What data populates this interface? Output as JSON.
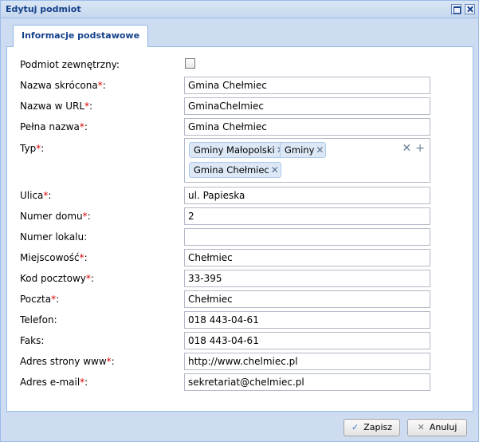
{
  "window": {
    "title": "Edytuj podmiot"
  },
  "tabs": [
    {
      "label": "Informacje podstawowe"
    }
  ],
  "form": {
    "external": {
      "label": "Podmiot zewnętrzny:",
      "checked": false
    },
    "short_name": {
      "label": "Nazwa skrócona",
      "value": "Gmina Chełmiec"
    },
    "url_name": {
      "label": "Nazwa w URL",
      "value": "GminaChelmiec"
    },
    "full_name": {
      "label": "Pełna nazwa",
      "value": "Gmina Chełmiec"
    },
    "type": {
      "label": "Typ",
      "tags": [
        "Gminy Małopolski",
        "Gminy",
        "Gmina Chełmiec"
      ]
    },
    "street": {
      "label": "Ulica",
      "value": "ul. Papieska"
    },
    "house_no": {
      "label": "Numer domu",
      "value": "2"
    },
    "flat_no": {
      "label": "Numer lokalu:",
      "value": ""
    },
    "city": {
      "label": "Miejscowość",
      "value": "Chełmiec"
    },
    "postal_code": {
      "label": "Kod pocztowy",
      "value": "33-395"
    },
    "post_office": {
      "label": "Poczta",
      "value": "Chełmiec"
    },
    "phone": {
      "label": "Telefon:",
      "value": "018 443-04-61"
    },
    "fax": {
      "label": "Faks:",
      "value": "018 443-04-61"
    },
    "website": {
      "label": "Adres strony www",
      "value": "http://www.chelmiec.pl"
    },
    "email": {
      "label": "Adres e-mail",
      "value": "sekretariat@chelmiec.pl"
    },
    "required_mark": "*",
    "colon": ":"
  },
  "footer": {
    "save_label": "Zapisz",
    "cancel_label": "Anuluj"
  },
  "colors": {
    "required": "#dd0000",
    "title_text": "#15428b",
    "border": "#99bbe8"
  }
}
